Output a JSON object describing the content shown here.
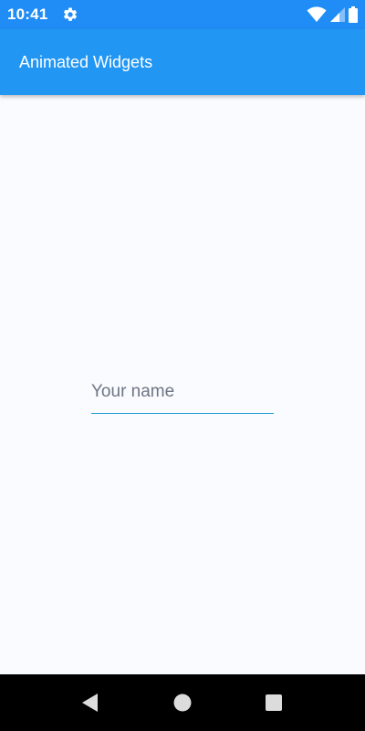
{
  "status_bar": {
    "time": "10:41",
    "icons": [
      "settings-gear-icon",
      "wifi-icon",
      "signal-icon",
      "battery-icon"
    ]
  },
  "app_bar": {
    "title": "Animated Widgets"
  },
  "form": {
    "name_placeholder": "Your name",
    "name_value": ""
  },
  "nav_bar": {
    "icons": [
      "back-icon",
      "home-icon",
      "recents-icon"
    ]
  },
  "colors": {
    "status_bar": "#1f8df5",
    "app_bar": "#2196f3",
    "background": "#f9fbfe",
    "input_underline": "#2aa3d6",
    "nav_bar": "#000000"
  }
}
